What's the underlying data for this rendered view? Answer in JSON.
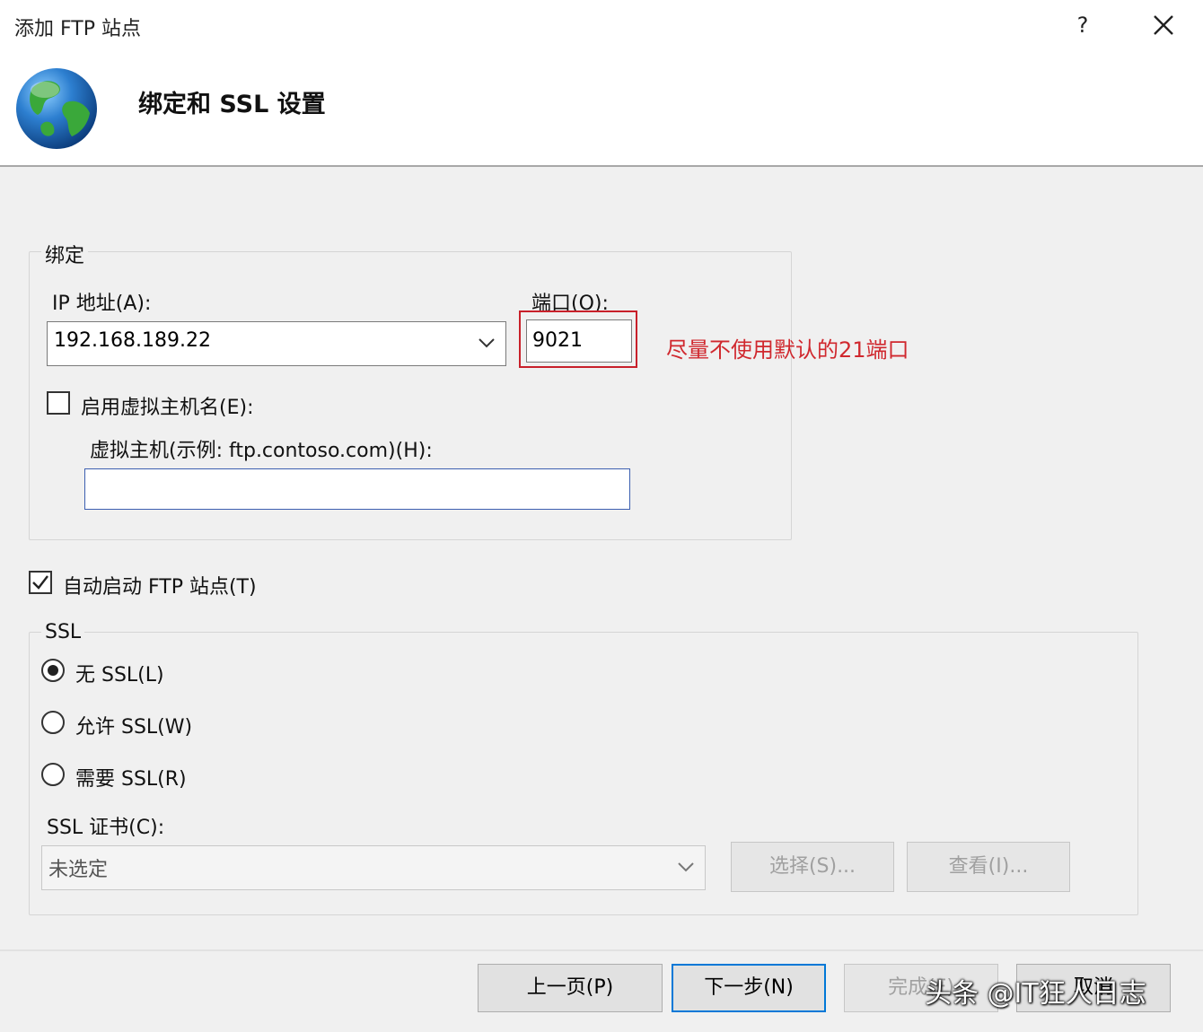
{
  "window": {
    "title": "添加 FTP 站点",
    "help_label": "?",
    "close_label": "✕",
    "page_heading": "绑定和 SSL 设置"
  },
  "binding": {
    "legend": "绑定",
    "ip_label": "IP 地址(A):",
    "ip_value": "192.168.189.22",
    "port_label": "端口(O):",
    "port_value": "9021",
    "port_annotation": "尽量不使用默认的21端口",
    "virtual_host_checkbox_label": "启用虚拟主机名(E):",
    "virtual_host_checked": false,
    "virtual_host_label": "虚拟主机(示例: ftp.contoso.com)(H):",
    "virtual_host_value": ""
  },
  "autostart": {
    "label": "自动启动 FTP 站点(T)",
    "checked": true
  },
  "ssl": {
    "legend": "SSL",
    "options": [
      {
        "label": "无 SSL(L)",
        "selected": true
      },
      {
        "label": "允许 SSL(W)",
        "selected": false
      },
      {
        "label": "需要 SSL(R)",
        "selected": false
      }
    ],
    "cert_label": "SSL 证书(C):",
    "cert_value": "未选定",
    "select_button": "选择(S)...",
    "view_button": "查看(I)..."
  },
  "footer": {
    "prev_button": "上一页(P)",
    "next_button": "下一步(N)",
    "finish_button": "完成(F)",
    "cancel_button": "取消",
    "watermark": "头条 @IT狂人日志"
  },
  "colors": {
    "accent": "#0078d7",
    "annotation": "#c8202a"
  }
}
